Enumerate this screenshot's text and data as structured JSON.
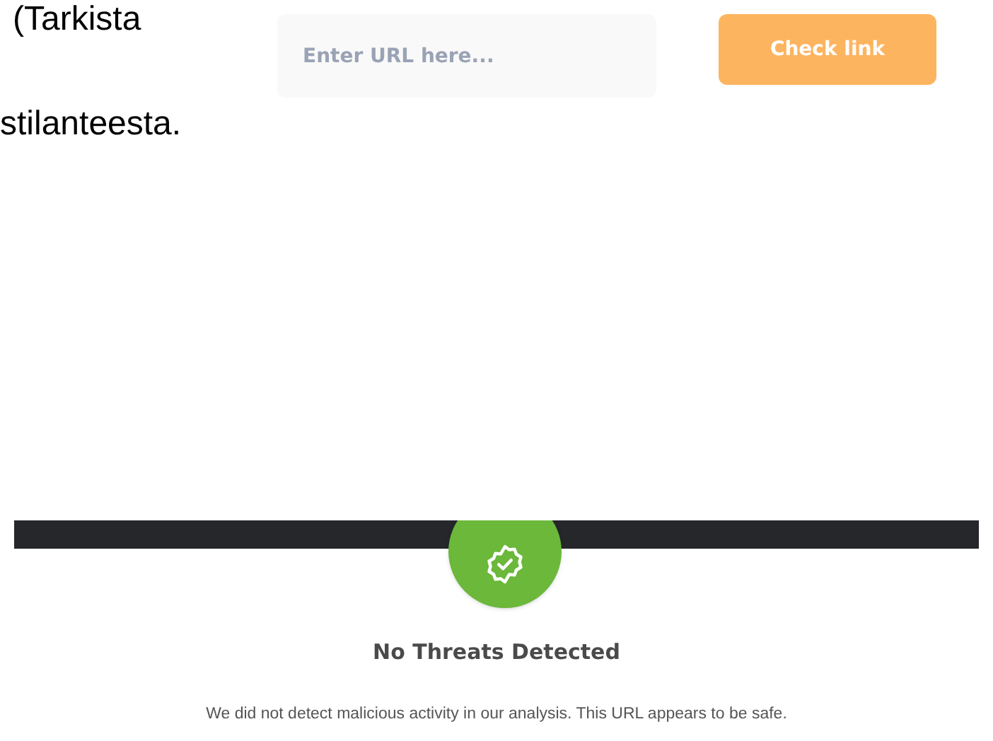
{
  "text_lines": [
    "(Tarkista",
    "stilanteesta."
  ],
  "url_field": {
    "placeholder": "Enter URL here..."
  },
  "check_button": {
    "label": "Check link"
  },
  "result": {
    "title": "No Threats Detected",
    "description": "We did not detect malicious activity in our analysis. This URL appears to be safe."
  }
}
